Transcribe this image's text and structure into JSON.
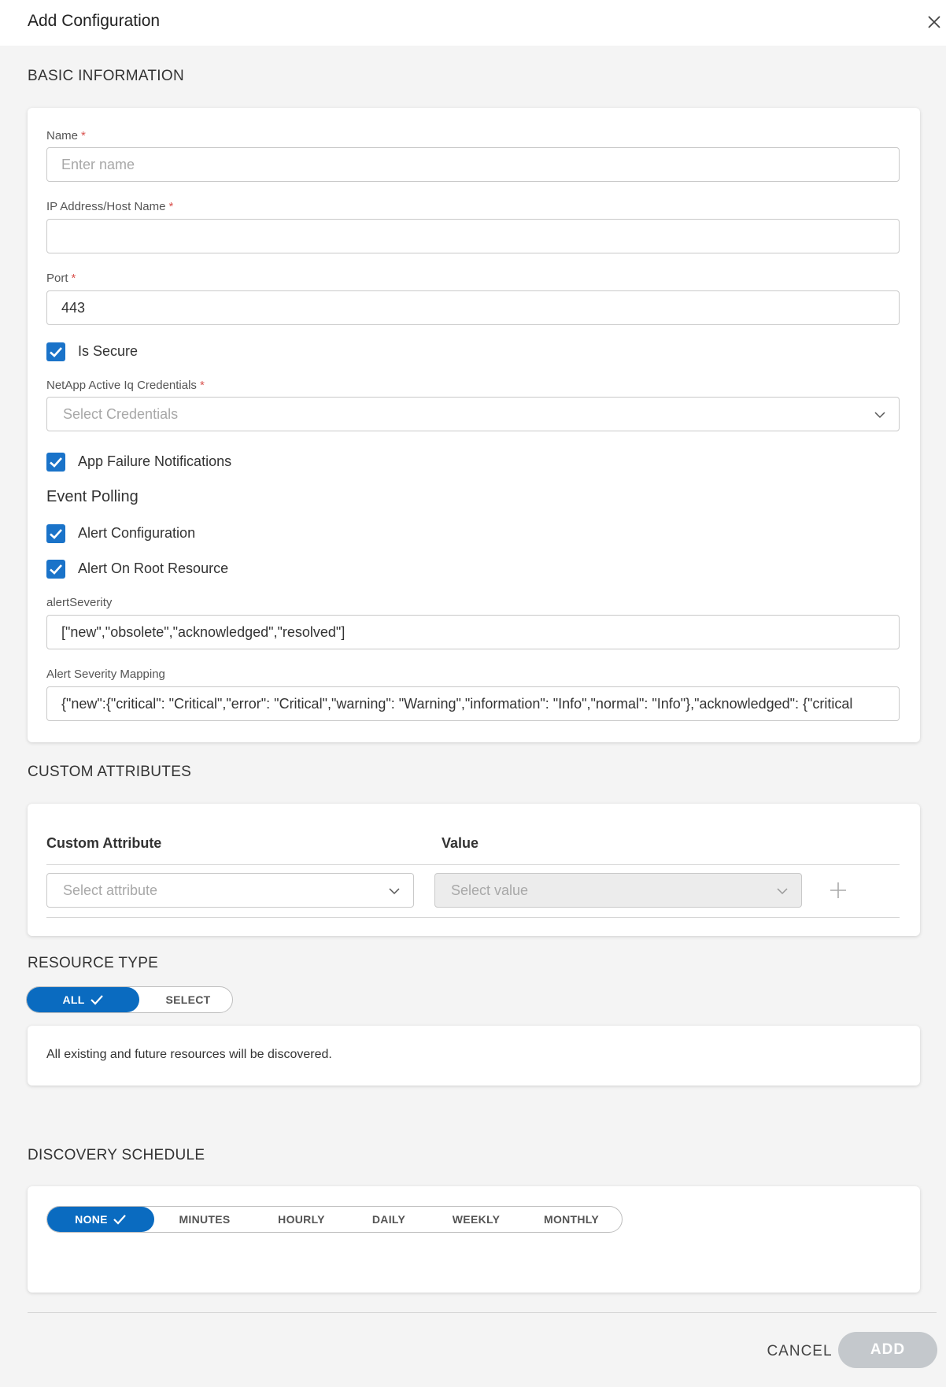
{
  "header": {
    "title": "Add Configuration"
  },
  "basic_info": {
    "section_title": "BASIC INFORMATION",
    "name": {
      "label": "Name",
      "required": "*",
      "placeholder": "Enter name",
      "value": ""
    },
    "ip": {
      "label": "IP Address/Host Name",
      "required": "*",
      "value": ""
    },
    "port": {
      "label": "Port",
      "required": "*",
      "value": "443"
    },
    "is_secure": {
      "label": "Is Secure",
      "checked": true
    },
    "credentials": {
      "label": "NetApp Active Iq Credentials",
      "required": "*",
      "placeholder": "Select Credentials"
    },
    "app_failure": {
      "label": "App Failure Notifications",
      "checked": true
    },
    "event_polling": {
      "heading": "Event Polling"
    },
    "alert_config": {
      "label": "Alert Configuration",
      "checked": true
    },
    "alert_root": {
      "label": "Alert On Root Resource",
      "checked": true
    },
    "alert_severity": {
      "label": "alertSeverity",
      "value": "[\"new\",\"obsolete\",\"acknowledged\",\"resolved\"]"
    },
    "severity_mapping": {
      "label": "Alert Severity Mapping",
      "value": "{\"new\":{\"critical\": \"Critical\",\"error\": \"Critical\",\"warning\": \"Warning\",\"information\": \"Info\",\"normal\": \"Info\"},\"acknowledged\": {\"critical"
    }
  },
  "custom_attributes": {
    "section_title": "CUSTOM ATTRIBUTES",
    "col_attribute": "Custom Attribute",
    "col_value": "Value",
    "attribute_placeholder": "Select attribute",
    "value_placeholder": "Select value"
  },
  "resource_type": {
    "section_title": "RESOURCE TYPE",
    "options": [
      "ALL",
      "SELECT"
    ],
    "selected": "ALL",
    "info": "All existing and future resources will be discovered."
  },
  "discovery_schedule": {
    "section_title": "DISCOVERY SCHEDULE",
    "options": [
      "NONE",
      "MINUTES",
      "HOURLY",
      "DAILY",
      "WEEKLY",
      "MONTHLY"
    ],
    "selected": "NONE"
  },
  "footer": {
    "cancel": "CANCEL",
    "add": "ADD"
  },
  "colors": {
    "accent": "#0a6bc0",
    "checkbox": "#1a73c9",
    "required": "#d9534f",
    "add_disabled": "#c4c8cc"
  }
}
